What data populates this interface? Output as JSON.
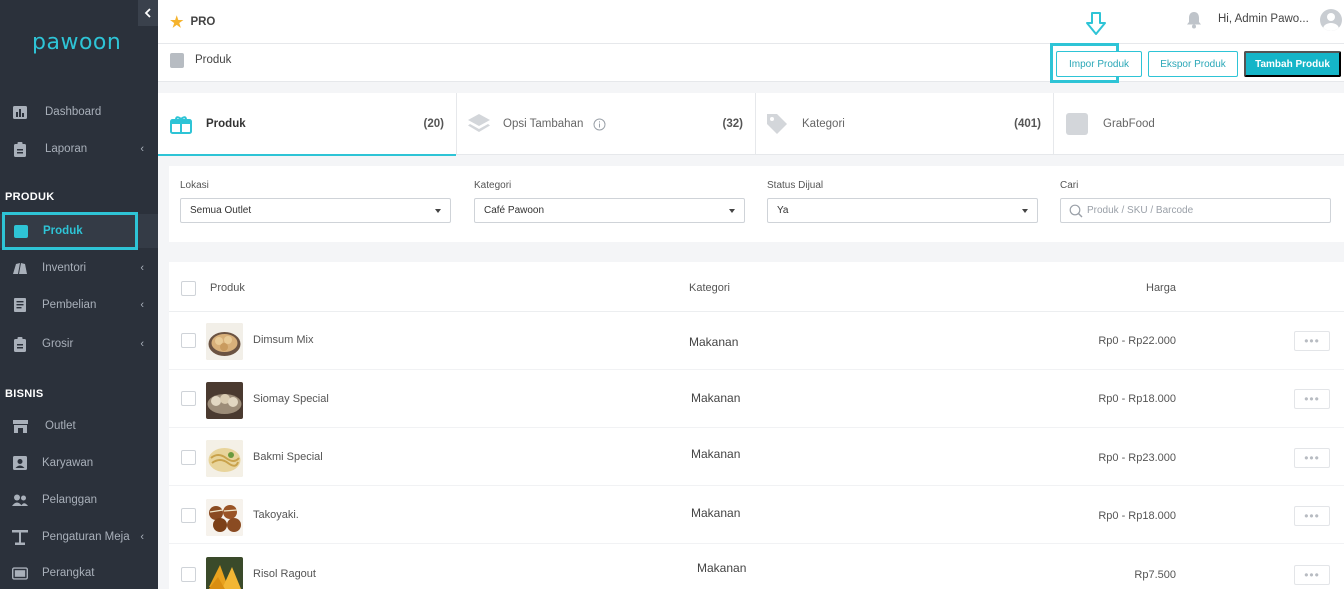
{
  "app": {
    "logo": "pawoon",
    "plan": "PRO"
  },
  "user": {
    "greeting": "Hi, Admin Pawo..."
  },
  "sidebar": {
    "items_top": [
      {
        "label": "Dashboard",
        "icon": "bar-chart-icon"
      },
      {
        "label": "Laporan",
        "icon": "clipboard-icon",
        "has_submenu": true
      }
    ],
    "section_produk": "PRODUK",
    "items_produk": [
      {
        "label": "Produk",
        "icon": "bag-icon",
        "active": true
      },
      {
        "label": "Inventori",
        "icon": "boxes-icon",
        "has_submenu": true
      },
      {
        "label": "Pembelian",
        "icon": "receipt-icon",
        "has_submenu": true
      },
      {
        "label": "Grosir",
        "icon": "clipboard-icon",
        "has_submenu": true
      }
    ],
    "section_bisnis": "BISNIS",
    "items_bisnis": [
      {
        "label": "Outlet",
        "icon": "store-icon"
      },
      {
        "label": "Karyawan",
        "icon": "id-card-icon"
      },
      {
        "label": "Pelanggan",
        "icon": "users-icon"
      },
      {
        "label": "Pengaturan Meja",
        "icon": "table-icon",
        "has_submenu": true
      },
      {
        "label": "Perangkat",
        "icon": "monitor-icon"
      }
    ]
  },
  "page": {
    "title": "Produk",
    "import_button": "Impor Produk",
    "export_button": "Ekspor Produk",
    "add_button": "Tambah Produk"
  },
  "tabs": [
    {
      "label": "Produk",
      "count": "(20)",
      "active": true
    },
    {
      "label": "Opsi Tambahan",
      "count": "(32)"
    },
    {
      "label": "Kategori",
      "count": "(401)"
    },
    {
      "label": "GrabFood",
      "count": ""
    }
  ],
  "filters": {
    "lokasi": {
      "label": "Lokasi",
      "value": "Semua Outlet"
    },
    "kategori": {
      "label": "Kategori",
      "value": "Café Pawoon"
    },
    "status": {
      "label": "Status Dijual",
      "value": "Ya"
    },
    "cari": {
      "label": "Cari",
      "placeholder": "Produk / SKU / Barcode"
    }
  },
  "table": {
    "headers": {
      "produk": "Produk",
      "kategori": "Kategori",
      "harga": "Harga"
    },
    "rows": [
      {
        "name": "Dimsum Mix",
        "category": "Makanan",
        "price": "Rp0 - Rp22.000"
      },
      {
        "name": "Siomay Special",
        "category": "Makanan",
        "price": "Rp0 - Rp18.000"
      },
      {
        "name": "Bakmi Special",
        "category": "Makanan",
        "price": "Rp0 - Rp23.000"
      },
      {
        "name": "Takoyaki.",
        "category": "Makanan",
        "price": "Rp0 - Rp18.000"
      },
      {
        "name": "Risol Ragout",
        "category": "Makanan",
        "price": "Rp7.500"
      }
    ],
    "more_label": "•••"
  },
  "colors": {
    "accent": "#2ec4d6",
    "sidebar": "#2b313b",
    "star": "#f5b32d"
  }
}
